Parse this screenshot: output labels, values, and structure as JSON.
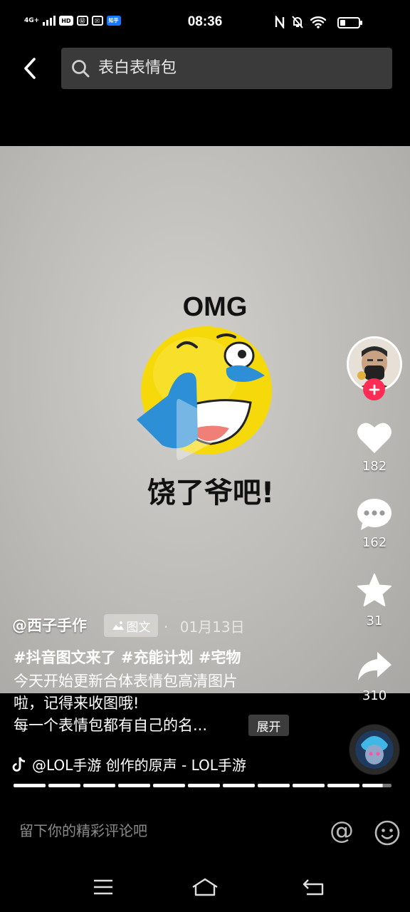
{
  "status_bar": {
    "network": "4G+",
    "badges": [
      "HD",
      "Ⓤ",
      "☒",
      "知乎"
    ],
    "time": "08:36"
  },
  "search": {
    "query": "表白表情包"
  },
  "media": {
    "image_top_text": "OMG",
    "image_bottom_text": "饶了爷吧!"
  },
  "rail": {
    "likes": "182",
    "comments": "162",
    "favorites": "31",
    "shares": "310"
  },
  "post": {
    "author": "@西子手作",
    "type_badge": "图文",
    "dot": "·",
    "date": "01月13日",
    "hashtags": "#抖音图文来了 #充能计划 #宅物",
    "desc_line1": "今天开始更新合体表情包高清图片",
    "desc_line2": "啦，记得来收图哦!",
    "desc_line3": "每一个表情包都有自己的名...",
    "expand": "展开"
  },
  "music": {
    "label": "@LOL手游 创作的原声 - LOL手游"
  },
  "progress": {
    "segments": 11,
    "current_fraction": 0.7
  },
  "comment": {
    "placeholder": "留下你的精彩评论吧",
    "at": "@"
  },
  "colors": {
    "accent": "#fe2c55",
    "emoji_yellow": "#f5d90a",
    "tear_blue": "#2d8fd6"
  }
}
